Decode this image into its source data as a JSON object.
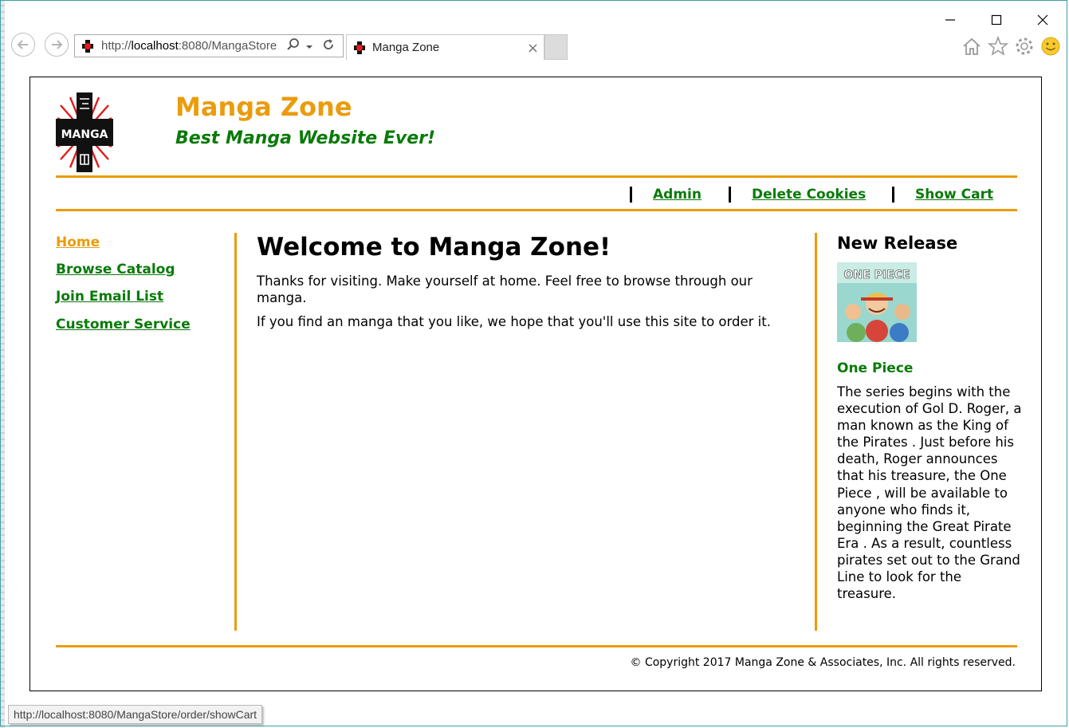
{
  "browser": {
    "address_url_prefix": "http://",
    "address_url_host": "localhost",
    "address_url_rest": ":8080/MangaStore",
    "tab_title": "Manga Zone",
    "tab_close": "×",
    "status_url": "http://localhost:8080/MangaStore/order/showCart",
    "icons": [
      "back-icon",
      "forward-icon",
      "search-icon",
      "dropdown-icon",
      "refresh-icon",
      "home-icon",
      "favorites-star-icon",
      "settings-gear-icon",
      "smiley-feedback-icon",
      "minimize-icon",
      "maximize-icon",
      "close-icon"
    ]
  },
  "header": {
    "logo_text": "MANGA",
    "title": "Manga Zone",
    "tagline": "Best Manga Website Ever!"
  },
  "top_nav": {
    "items": [
      {
        "label": "Admin"
      },
      {
        "label": "Delete Cookies"
      },
      {
        "label": "Show Cart"
      }
    ]
  },
  "side_nav": {
    "items": [
      {
        "label": "Home",
        "active": true
      },
      {
        "label": "Browse Catalog",
        "active": false
      },
      {
        "label": "Join Email List",
        "active": false
      },
      {
        "label": "Customer Service",
        "active": false
      }
    ]
  },
  "main": {
    "heading": "Welcome to Manga Zone!",
    "paragraphs": [
      "Thanks for visiting. Make yourself at home. Feel free to browse through our manga.",
      "If you find an manga that you like, we hope that you'll use this site to order it."
    ]
  },
  "aside": {
    "heading": "New Release",
    "cover_text": "ONE PIECE",
    "book_title": "One Piece",
    "description": "The series begins with the execution of Gol D. Roger, a man known as the King of the Pirates . Just before his death, Roger announces that his treasure, the One Piece , will be available to anyone who finds it, beginning the Great Pirate Era . As a result, countless pirates set out to the Grand Line to look for the treasure."
  },
  "footer": {
    "copyright": "© Copyright 2017 Manga Zone & Associates, Inc. All rights reserved."
  },
  "colors": {
    "accent_orange": "#ea9c0c",
    "link_green": "#0a7a0a",
    "text_black": "#000000"
  }
}
